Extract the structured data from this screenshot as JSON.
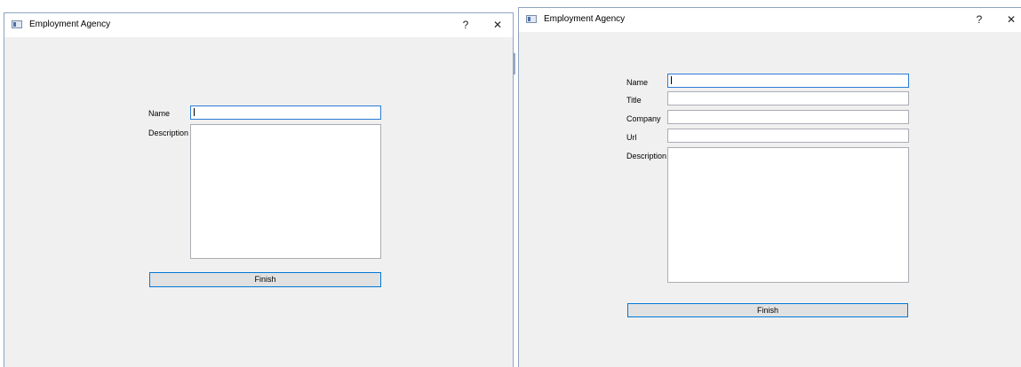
{
  "windows": [
    {
      "title": "Employment Agency",
      "help_label": "?",
      "close_label": "✕",
      "fields": [
        {
          "label": "Name",
          "value": ""
        },
        {
          "label": "Description",
          "value": ""
        }
      ],
      "finish_label": "Finish"
    },
    {
      "title": "Employment Agency",
      "help_label": "?",
      "close_label": "✕",
      "fields": [
        {
          "label": "Name",
          "value": ""
        },
        {
          "label": "Title",
          "value": ""
        },
        {
          "label": "Company",
          "value": ""
        },
        {
          "label": "Url",
          "value": ""
        },
        {
          "label": "Description",
          "value": ""
        }
      ],
      "finish_label": "Finish"
    }
  ]
}
